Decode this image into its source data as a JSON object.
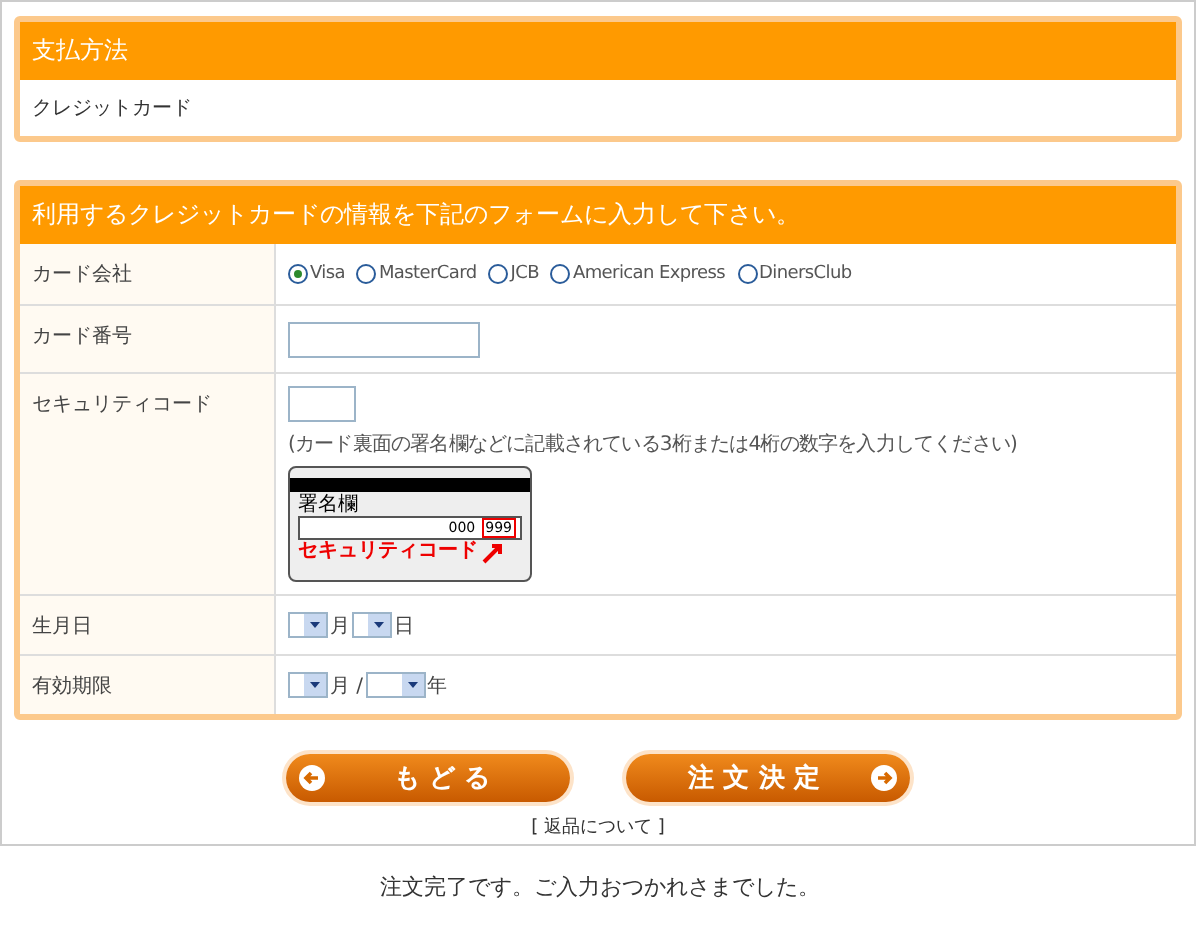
{
  "payment_panel": {
    "title": "支払方法",
    "value": "クレジットカード"
  },
  "card_panel": {
    "title": "利用するクレジットカードの情報を下記のフォームに入力して下さい。",
    "rows": [
      {
        "kind": "radios",
        "label": "カード会社",
        "options": [
          {
            "label": "Visa",
            "selected": true
          },
          {
            "label": "MasterCard",
            "selected": false
          },
          {
            "label": "JCB",
            "selected": false
          },
          {
            "label": "American Express",
            "selected": false
          },
          {
            "label": "DinersClub",
            "selected": false
          }
        ]
      },
      {
        "kind": "text",
        "label": "カード番号"
      },
      {
        "kind": "security",
        "label": "セキュリティコード",
        "hint": "(カード裏面の署名欄などに記載されている3桁または4桁の数字を入力してください)",
        "card": {
          "signature_label": "署名欄",
          "number": "000",
          "code": "999",
          "caption": "セキュリティコード"
        }
      },
      {
        "kind": "selects",
        "label": "生月日",
        "parts": [
          {
            "kind": "month",
            "unit": "月"
          },
          {
            "kind": "day",
            "unit": "日"
          }
        ]
      },
      {
        "kind": "selects",
        "label": "有効期限",
        "parts": [
          {
            "kind": "month",
            "unit": "月 /"
          },
          {
            "kind": "year",
            "unit": "年"
          }
        ]
      }
    ]
  },
  "buttons": [
    {
      "kind": "back",
      "label": "も ど る"
    },
    {
      "kind": "submit",
      "label": "注 文 決 定"
    }
  ],
  "link": "[ 返品について ]",
  "footer": "注文完了です。ご入力おつかれさまでした。"
}
